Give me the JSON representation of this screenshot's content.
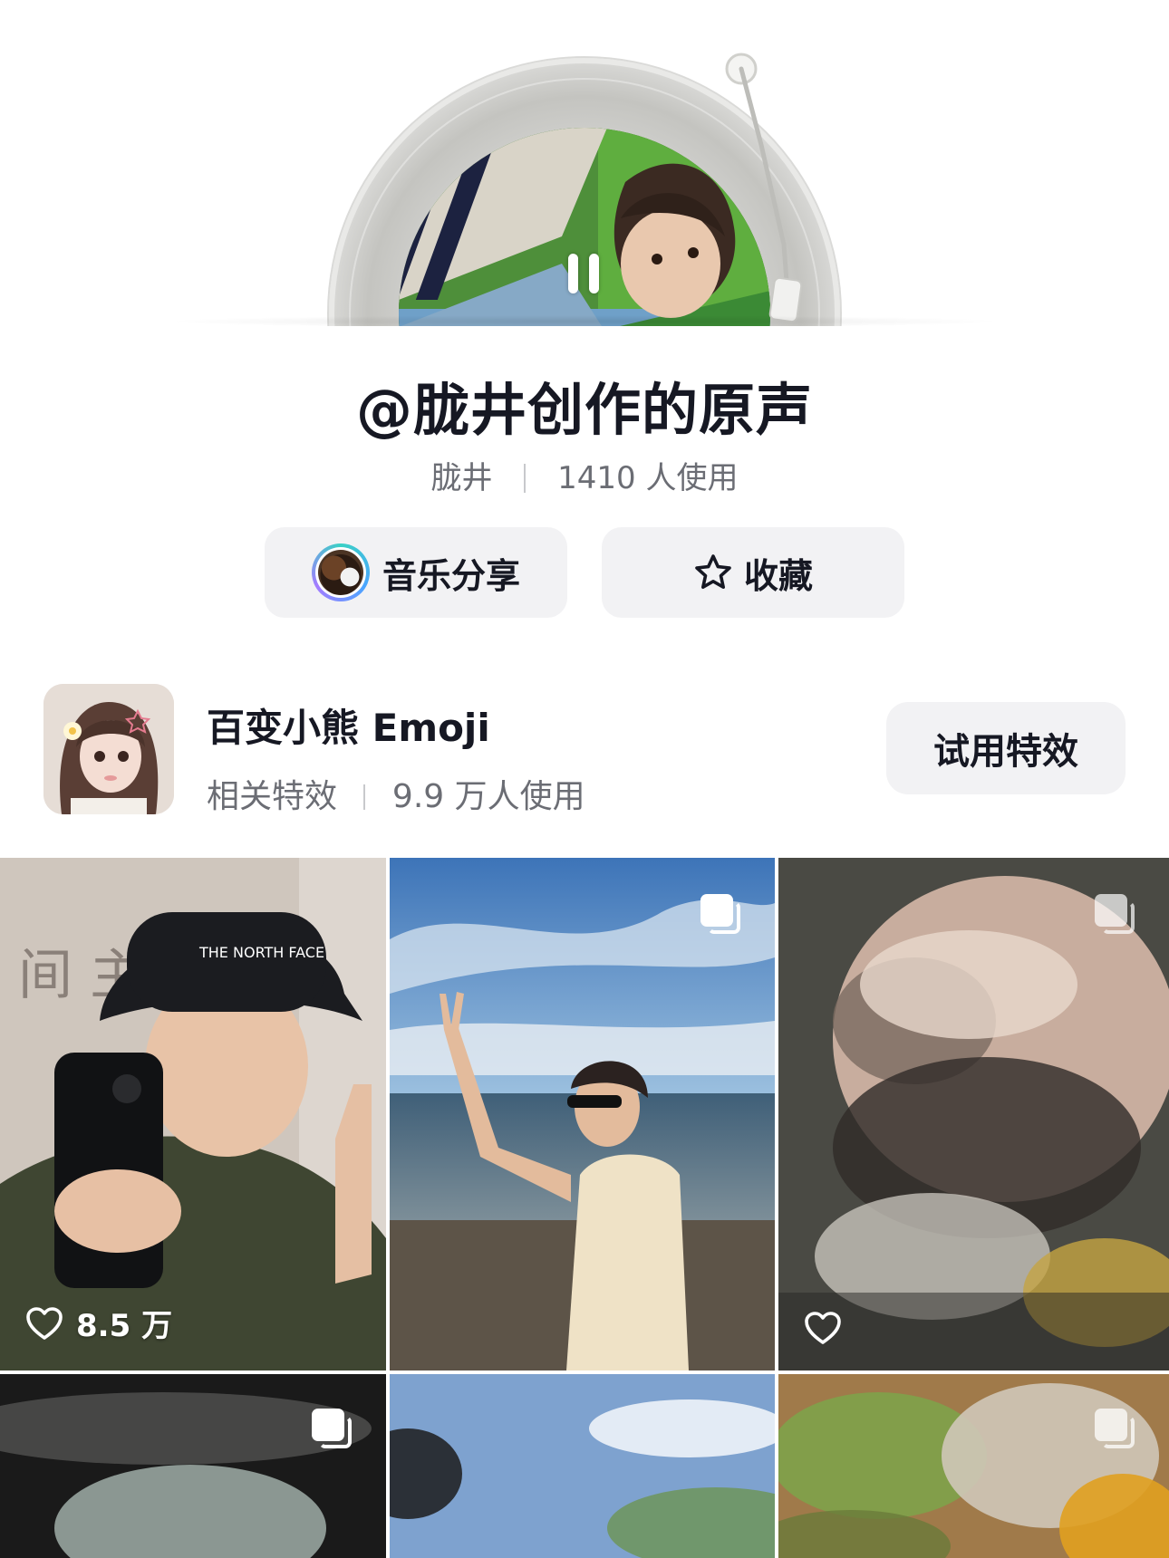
{
  "sound": {
    "title": "@胧井创作的原声",
    "author": "胧井",
    "usage": "1410 人使用"
  },
  "actions": {
    "share_label": "音乐分享",
    "favorite_label": "收藏"
  },
  "effect": {
    "name": "百变小熊 Emoji",
    "category": "相关特效",
    "usage": "9.9 万人使用",
    "try_label": "试用特效"
  },
  "videos": [
    {
      "likes": "8.5 万",
      "multi_image": false
    },
    {
      "likes": "",
      "multi_image": true
    },
    {
      "likes": "",
      "multi_image": true
    },
    {
      "likes": "",
      "multi_image": true
    },
    {
      "likes": "",
      "multi_image": false
    },
    {
      "likes": "",
      "multi_image": true
    }
  ],
  "icons": {
    "pause": "pause-icon",
    "star": "star-icon",
    "heart": "heart-icon",
    "multi": "multi-image-icon"
  },
  "colors": {
    "text_primary": "#161823",
    "text_secondary": "#6b6d74",
    "button_bg": "#f2f2f4"
  }
}
